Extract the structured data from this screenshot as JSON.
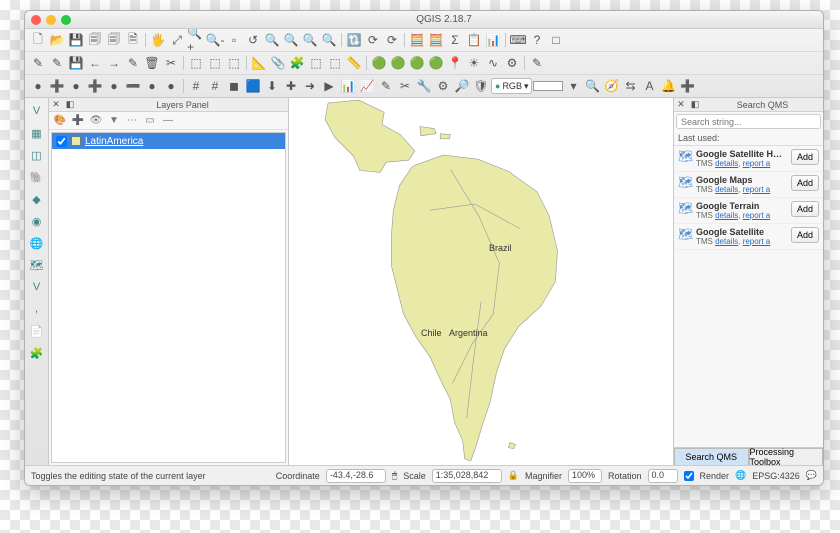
{
  "window_title": "QGIS 2.18.7",
  "toolbar_rows": {
    "row1": "🗋 📂 💾 🗐 🗐 🗎 | 🖐 ⤢ 🔍+ 🔍- ▫ ↺ 🔍 🔍 🔍 🔍 | 🔃 ⟳ ⟳ | 🧮 🧮 Σ 📋 📊 | ⌨ ? □",
    "row2": "✎ ✎ 💾 ← → ✎ 🗑 ✂ | ⬚ ⬚ ⬚ | 📐 📎 🧩 ⬚ ⬚ 📏 | 🟢 🟢 🟢 🟢 📍 ☀ ∿ ⚙ | ✎",
    "row3": "● ➕ ● ➕ ● ➖ ● ● | # # ◼ 🟦 ⬇ ✚ ➜ ▶ 📊 📈 ✎ ✂ 🔧 ⚙ 🔎 🛡"
  },
  "rgb_label": "RGB",
  "layers_panel": {
    "title": "Layers Panel",
    "layer_name": "LatinAmerica",
    "checked": true
  },
  "map_labels": {
    "brazil": "Brazil",
    "chile": "Chile",
    "argentina": "Argentina"
  },
  "qms": {
    "panel_title": "Search QMS",
    "search_placeholder": "Search string...",
    "last_used_label": "Last used:",
    "add_label": "Add",
    "items": [
      {
        "title": "Google Satellite Hybrid",
        "type": "TMS",
        "d": "details",
        "r": "report a"
      },
      {
        "title": "Google Maps",
        "type": "TMS",
        "d": "details",
        "r": "report a"
      },
      {
        "title": "Google Terrain",
        "type": "TMS",
        "d": "details",
        "r": "report a"
      },
      {
        "title": "Google Satellite",
        "type": "TMS",
        "d": "details",
        "r": "report a"
      }
    ],
    "tab_active": "Search QMS",
    "tab_inactive": "Processing Toolbox"
  },
  "status": {
    "hint": "Toggles the editing state of the current layer",
    "coord_label": "Coordinate",
    "coord_value": "-43.4,-28.6",
    "scale_label": "Scale",
    "scale_value": "1:35,028,842",
    "mag_label": "Magnifier",
    "mag_value": "100%",
    "rot_label": "Rotation",
    "rot_value": "0.0",
    "render_label": "Render",
    "epsg": "EPSG:4326"
  }
}
